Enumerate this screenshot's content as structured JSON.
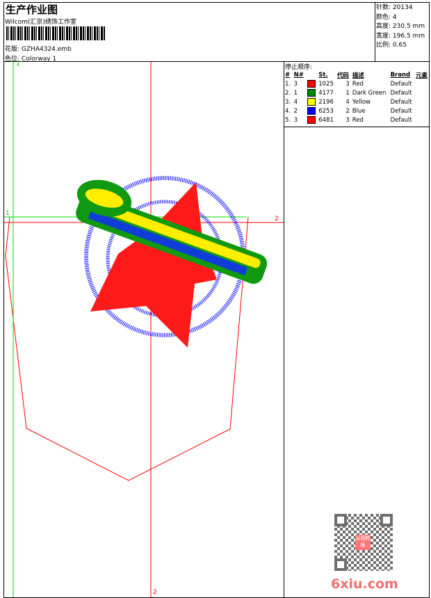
{
  "header": {
    "title": "生产作业图",
    "company": "Wilcom(汇京)绣饰工作室",
    "design_label": "花版:",
    "design_value": "GZHA4324.emb",
    "colorway_label": "色位:",
    "colorway_value": "Colorway 1"
  },
  "info": [
    {
      "label": "针数:",
      "value": "20134"
    },
    {
      "label": "颜色:",
      "value": "4"
    },
    {
      "label": "高度:",
      "value": "230.5 mm"
    },
    {
      "label": "宽度:",
      "value": "196.5 mm"
    },
    {
      "label": "比例:",
      "value": "0.65"
    }
  ],
  "stops": {
    "title": "停止顺序:",
    "headers": [
      "#",
      "N#",
      "St.",
      "代码",
      "描述",
      "Brand",
      "元素"
    ],
    "rows": [
      {
        "n": "1.",
        "nn": "3",
        "color": "#ff0000",
        "st": "1025",
        "code": "3",
        "desc": "Red",
        "brand": "Default"
      },
      {
        "n": "2.",
        "nn": "1",
        "color": "#008800",
        "st": "4177",
        "code": "1",
        "desc": "Dark Green",
        "brand": "Default"
      },
      {
        "n": "3.",
        "nn": "4",
        "color": "#ffff00",
        "st": "2196",
        "code": "4",
        "desc": "Yellow",
        "brand": "Default"
      },
      {
        "n": "4.",
        "nn": "2",
        "color": "#0000ff",
        "st": "6253",
        "code": "2",
        "desc": "Blue",
        "brand": "Default"
      },
      {
        "n": "5.",
        "nn": "3",
        "color": "#ff0000",
        "st": "6481",
        "code": "3",
        "desc": "Red",
        "brand": "Default"
      }
    ]
  },
  "markers": {
    "green_top": "1",
    "green_left": "1",
    "red_right": "2",
    "red_bottom": "2"
  },
  "watermark": "6xiu.com",
  "stamp": "以图制版"
}
